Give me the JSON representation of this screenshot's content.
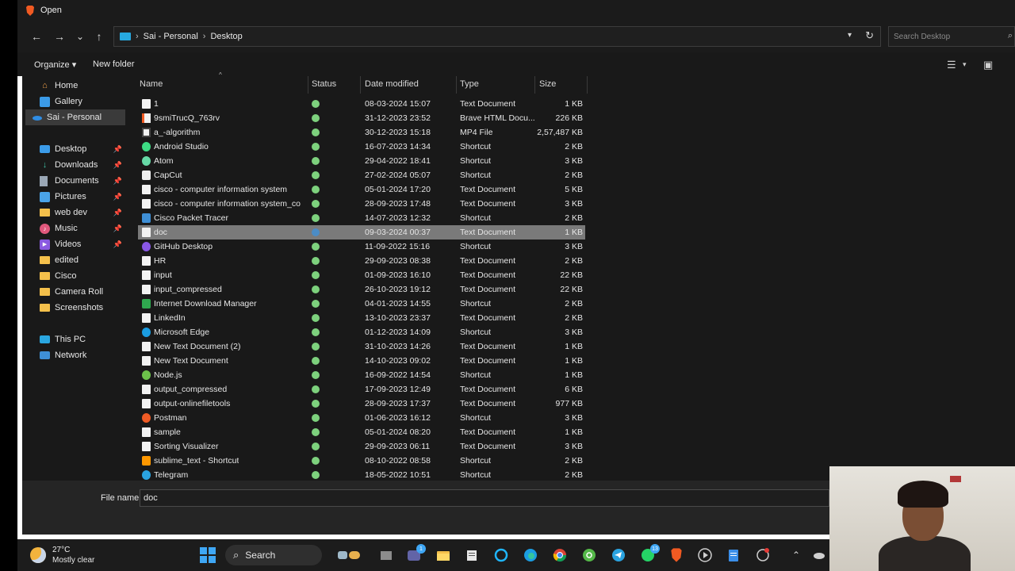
{
  "window": {
    "title": "Open"
  },
  "nav": {
    "back": "←",
    "forward": "→",
    "recent": "⌄",
    "up": "↑",
    "breadcrumb": [
      "Sai - Personal",
      "Desktop"
    ],
    "refresh": "↻",
    "search_placeholder": "Search Desktop"
  },
  "toolbar": {
    "organize": "Organize ▾",
    "new_folder": "New folder"
  },
  "sidebar": {
    "items": [
      {
        "label": "Home",
        "icon": "home-icon",
        "pinned": false
      },
      {
        "label": "Gallery",
        "icon": "gallery-icon",
        "pinned": false
      },
      {
        "label": "Sai - Personal",
        "icon": "onedrive-icon",
        "pinned": false,
        "selected": true
      },
      {
        "label": "Desktop",
        "icon": "desktop-icon",
        "pinned": true
      },
      {
        "label": "Downloads",
        "icon": "download-icon",
        "pinned": true
      },
      {
        "label": "Documents",
        "icon": "documents-icon",
        "pinned": true
      },
      {
        "label": "Pictures",
        "icon": "pictures-icon",
        "pinned": true
      },
      {
        "label": "web dev",
        "icon": "folder-icon",
        "pinned": true
      },
      {
        "label": "Music",
        "icon": "music-icon",
        "pinned": true
      },
      {
        "label": "Videos",
        "icon": "videos-icon",
        "pinned": true
      },
      {
        "label": "edited",
        "icon": "folder-icon",
        "pinned": false
      },
      {
        "label": "Cisco",
        "icon": "folder-icon",
        "pinned": false
      },
      {
        "label": "Camera Roll",
        "icon": "folder-icon",
        "pinned": false
      },
      {
        "label": "Screenshots",
        "icon": "folder-icon",
        "pinned": false
      },
      {
        "label": "This PC",
        "icon": "this-pc-icon",
        "pinned": false
      },
      {
        "label": "Network",
        "icon": "network-icon",
        "pinned": false
      }
    ]
  },
  "columns": {
    "name": "Name",
    "status": "Status",
    "date": "Date modified",
    "type": "Type",
    "size": "Size"
  },
  "files": [
    {
      "name": "1",
      "date": "08-03-2024 15:07",
      "type": "Text Document",
      "size": "1 KB",
      "icon": "text-file-icon"
    },
    {
      "name": "9smiTrucQ_763rv",
      "date": "31-12-2023 23:52",
      "type": "Brave HTML Docu...",
      "size": "226 KB",
      "icon": "brave-html-icon"
    },
    {
      "name": "a_-algorithm",
      "date": "30-12-2023 15:18",
      "type": "MP4 File",
      "size": "2,57,487 KB",
      "icon": "video-file-icon"
    },
    {
      "name": "Android Studio",
      "date": "16-07-2023 14:34",
      "type": "Shortcut",
      "size": "2 KB",
      "icon": "android-studio-icon"
    },
    {
      "name": "Atom",
      "date": "29-04-2022 18:41",
      "type": "Shortcut",
      "size": "3 KB",
      "icon": "atom-icon"
    },
    {
      "name": "CapCut",
      "date": "27-02-2024 05:07",
      "type": "Shortcut",
      "size": "2 KB",
      "icon": "capcut-icon"
    },
    {
      "name": "cisco - computer information system",
      "date": "05-01-2024 17:20",
      "type": "Text Document",
      "size": "5 KB",
      "icon": "text-file-icon"
    },
    {
      "name": "cisco - computer information system_co...",
      "date": "28-09-2023 17:48",
      "type": "Text Document",
      "size": "3 KB",
      "icon": "text-file-icon"
    },
    {
      "name": "Cisco Packet Tracer",
      "date": "14-07-2023 12:32",
      "type": "Shortcut",
      "size": "2 KB",
      "icon": "packet-tracer-icon"
    },
    {
      "name": "doc",
      "date": "09-03-2024 00:37",
      "type": "Text Document",
      "size": "1 KB",
      "icon": "text-file-icon",
      "selected": true
    },
    {
      "name": "GitHub Desktop",
      "date": "11-09-2022 15:16",
      "type": "Shortcut",
      "size": "3 KB",
      "icon": "github-desktop-icon"
    },
    {
      "name": "HR",
      "date": "29-09-2023 08:38",
      "type": "Text Document",
      "size": "2 KB",
      "icon": "text-file-icon"
    },
    {
      "name": "input",
      "date": "01-09-2023 16:10",
      "type": "Text Document",
      "size": "22 KB",
      "icon": "text-file-icon"
    },
    {
      "name": "input_compressed",
      "date": "26-10-2023 19:12",
      "type": "Text Document",
      "size": "22 KB",
      "icon": "text-file-icon"
    },
    {
      "name": "Internet Download Manager",
      "date": "04-01-2023 14:55",
      "type": "Shortcut",
      "size": "2 KB",
      "icon": "idm-icon"
    },
    {
      "name": "LinkedIn",
      "date": "13-10-2023 23:37",
      "type": "Text Document",
      "size": "2 KB",
      "icon": "text-file-icon"
    },
    {
      "name": "Microsoft Edge",
      "date": "01-12-2023 14:09",
      "type": "Shortcut",
      "size": "3 KB",
      "icon": "edge-icon"
    },
    {
      "name": "New Text Document (2)",
      "date": "31-10-2023 14:26",
      "type": "Text Document",
      "size": "1 KB",
      "icon": "text-file-icon"
    },
    {
      "name": "New Text Document",
      "date": "14-10-2023 09:02",
      "type": "Text Document",
      "size": "1 KB",
      "icon": "text-file-icon"
    },
    {
      "name": "Node.js",
      "date": "16-09-2022 14:54",
      "type": "Shortcut",
      "size": "1 KB",
      "icon": "nodejs-icon"
    },
    {
      "name": "output_compressed",
      "date": "17-09-2023 12:49",
      "type": "Text Document",
      "size": "6 KB",
      "icon": "text-file-icon"
    },
    {
      "name": "output-onlinefiletools",
      "date": "28-09-2023 17:37",
      "type": "Text Document",
      "size": "977 KB",
      "icon": "text-file-icon"
    },
    {
      "name": "Postman",
      "date": "01-06-2023 16:12",
      "type": "Shortcut",
      "size": "3 KB",
      "icon": "postman-icon"
    },
    {
      "name": "sample",
      "date": "05-01-2024 08:20",
      "type": "Text Document",
      "size": "1 KB",
      "icon": "text-file-icon"
    },
    {
      "name": "Sorting Visualizer",
      "date": "29-09-2023 06:11",
      "type": "Text Document",
      "size": "3 KB",
      "icon": "text-file-icon"
    },
    {
      "name": "sublime_text - Shortcut",
      "date": "08-10-2022 08:58",
      "type": "Shortcut",
      "size": "2 KB",
      "icon": "sublime-icon"
    },
    {
      "name": "Telegram",
      "date": "18-05-2022 10:51",
      "type": "Shortcut",
      "size": "2 KB",
      "icon": "telegram-icon"
    }
  ],
  "filename": {
    "label": "File name:",
    "value": "doc"
  },
  "taskbar": {
    "weather_temp": "27°C",
    "weather_cond": "Mostly clear",
    "search_label": "Search",
    "teams_badge": "1",
    "whatsapp_badge": "13"
  },
  "colors": {
    "accent": "#3fa7f5",
    "status_synced": "#7dd17d",
    "selected_row": "#7a7a7a",
    "folder": "#f4c04b"
  }
}
